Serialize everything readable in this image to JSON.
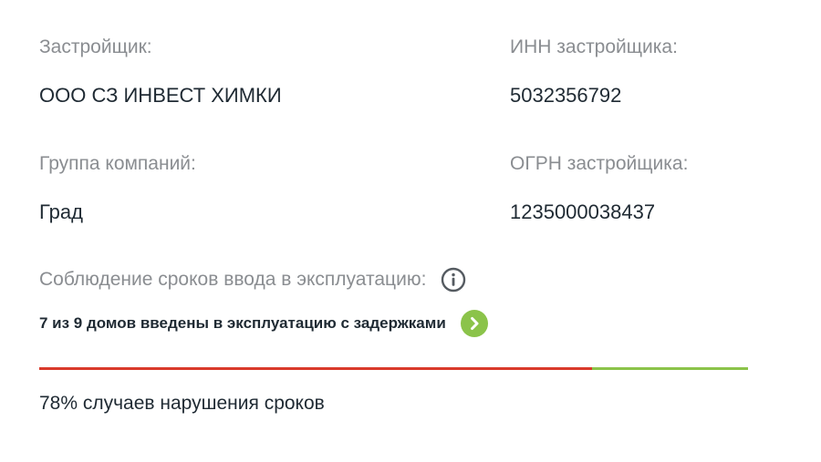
{
  "developer": {
    "label": "Застройщик:",
    "value": "ООО СЗ ИНВЕСТ ХИМКИ"
  },
  "inn": {
    "label": "ИНН застройщика:",
    "value": "5032356792"
  },
  "group": {
    "label": "Группа компаний:",
    "value": "Град"
  },
  "ogrn": {
    "label": "ОГРН застройщика:",
    "value": "1235000038437"
  },
  "deadline": {
    "label": "Соблюдение сроков ввода в эксплуатацию:",
    "info_icon": "info-icon",
    "houses_text": "7 из 9 домов введены в эксплуатацию с задержками",
    "more_icon": "chevron-right-icon",
    "violation_fraction": 0.78,
    "violation_text": "78% случаев нарушения сроков",
    "colors": {
      "violation": "#d93a2b",
      "ok": "#8bc34a",
      "more_button": "#8bc34a"
    }
  }
}
